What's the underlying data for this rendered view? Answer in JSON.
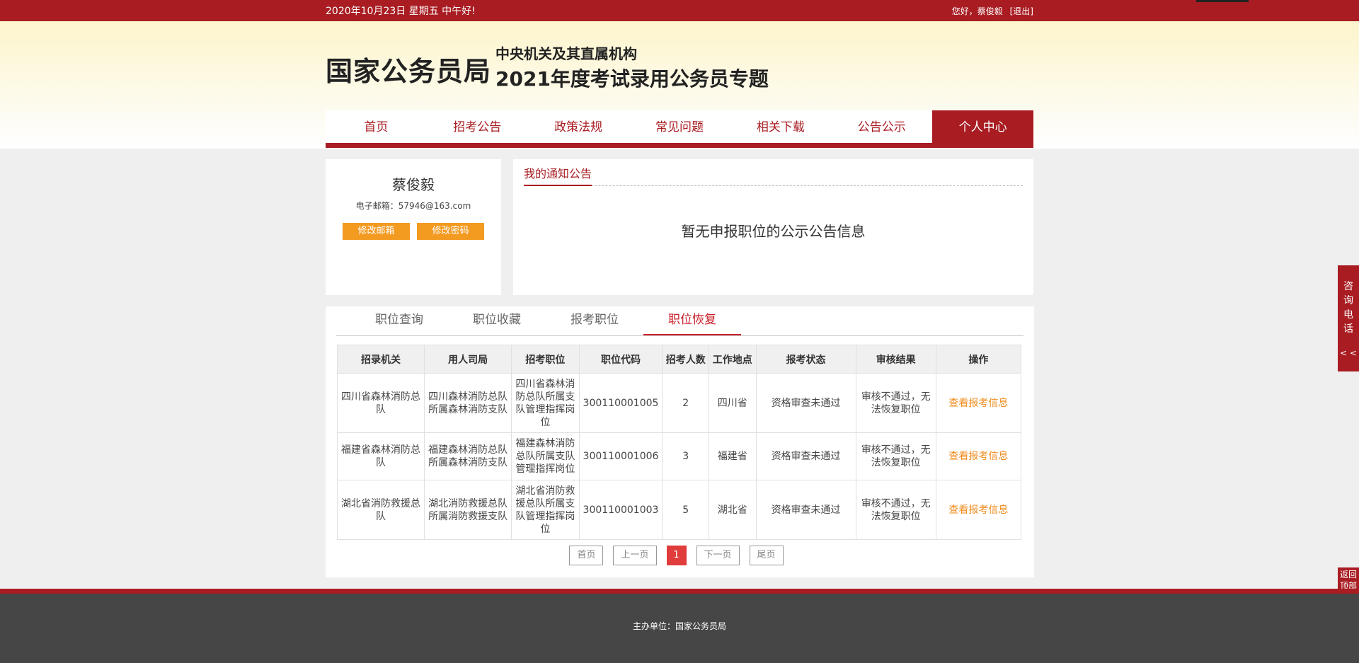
{
  "topbar": {
    "date_text": "2020年10月23日  星期五  中午好!",
    "greeting": "您好，蔡俊毅",
    "logout": "[退出]"
  },
  "header": {
    "logo": "国家公务员局",
    "subtitle1": "中央机关及其直属机构",
    "subtitle2": "2021年度考试录用公务员专题"
  },
  "nav": [
    "首页",
    "招考公告",
    "政策法规",
    "常见问题",
    "相关下载",
    "公告公示",
    "个人中心"
  ],
  "profile": {
    "name": "蔡俊毅",
    "email": "电子邮箱：57946@163.com",
    "edit_email": "修改邮箱",
    "edit_password": "修改密码"
  },
  "notice": {
    "title": "我的通知公告",
    "empty": "暂无申报职位的公示公告信息"
  },
  "tabs": [
    "职位查询",
    "职位收藏",
    "报考职位",
    "职位恢复"
  ],
  "table": {
    "headers": [
      "招录机关",
      "用人司局",
      "招考职位",
      "职位代码",
      "招考人数",
      "工作地点",
      "报考状态",
      "审核结果",
      "操作"
    ],
    "rows": [
      [
        "四川省森林消防总队",
        "四川森林消防总队所属森林消防支队",
        "四川省森林消防总队所属支队管理指挥岗位",
        "300110001005",
        "2",
        "四川省",
        "资格审查未通过",
        "审核不通过，无法恢复职位",
        "查看报考信息"
      ],
      [
        "福建省森林消防总队",
        "福建森林消防总队所属森林消防支队",
        "福建森林消防总队所属支队管理指挥岗位",
        "300110001006",
        "3",
        "福建省",
        "资格审查未通过",
        "审核不通过，无法恢复职位",
        "查看报考信息"
      ],
      [
        "湖北省消防救援总队",
        "湖北消防救援总队所属消防救援支队",
        "湖北省消防救援总队所属支队管理指挥岗位",
        "300110001003",
        "5",
        "湖北省",
        "资格审查未通过",
        "审核不通过，无法恢复职位",
        "查看报考信息"
      ]
    ]
  },
  "pager": {
    "first": "首页",
    "prev": "上一页",
    "current": "1",
    "next": "下一页",
    "last": "尾页"
  },
  "side": {
    "consult": [
      "咨",
      "询",
      "电",
      "话"
    ],
    "arrows": "< <",
    "back_top_1": "返回",
    "back_top_2": "顶部"
  },
  "footer": {
    "host": "主办单位：国家公务员局"
  },
  "colors": {
    "brand_red": "#a81c22",
    "orange": "#f39a21",
    "link_orange": "#f08c1e"
  }
}
